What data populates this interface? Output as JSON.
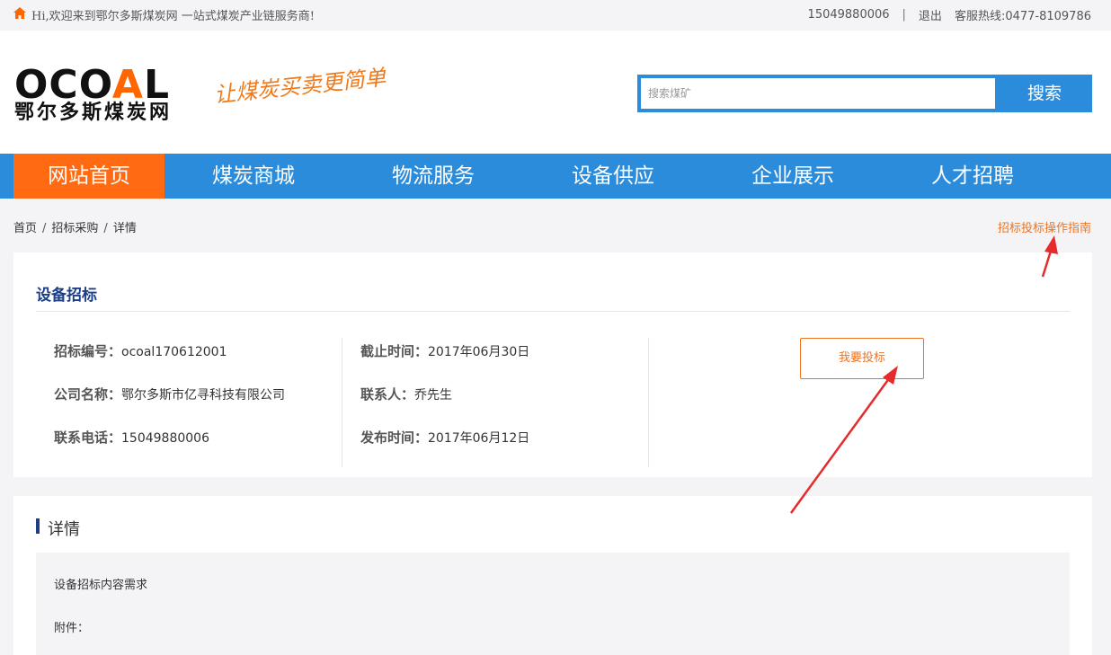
{
  "topbar": {
    "greeting": "Hi,欢迎来到鄂尔多斯煤炭网 一站式煤炭产业链服务商!",
    "phone": "15049880006",
    "divider": "|",
    "logout": "退出",
    "hotline": "客服热线:0477-8109786"
  },
  "header": {
    "logo_mark_left": "OCO",
    "logo_mark_a": "A",
    "logo_mark_right": "L",
    "logo_cn": "鄂尔多斯煤炭网",
    "slogan": "让煤炭买卖更简单",
    "search_placeholder": "搜索煤矿",
    "search_button": "搜索"
  },
  "nav": {
    "items": [
      {
        "label": "网站首页"
      },
      {
        "label": "煤炭商城"
      },
      {
        "label": "物流服务"
      },
      {
        "label": "设备供应"
      },
      {
        "label": "企业展示"
      },
      {
        "label": "人才招聘"
      }
    ]
  },
  "breadcrumb": {
    "items": [
      "首页",
      "招标采购",
      "详情"
    ],
    "separator": "/",
    "guide": "招标投标操作指南"
  },
  "tender": {
    "title": "设备招标",
    "fields": {
      "bid_no_label": "招标编号：",
      "bid_no": "ocoal170612001",
      "deadline_label": "截止时间：",
      "deadline": "2017年06月30日",
      "company_label": "公司名称：",
      "company": "鄂尔多斯市亿寻科技有限公司",
      "contact_label": "联系人：",
      "contact": "乔先生",
      "phone_label": "联系电话：",
      "phone": "15049880006",
      "publish_label": "发布时间：",
      "publish": "2017年06月12日"
    },
    "bid_button": "我要投标"
  },
  "detail": {
    "title": "详情",
    "content": "设备招标内容需求",
    "attachment": "附件："
  },
  "colors": {
    "brand_blue": "#2b8cdc",
    "accent_orange": "#ff6a13",
    "title_navy": "#1d3f87",
    "annotation_red": "#e52b2b"
  }
}
